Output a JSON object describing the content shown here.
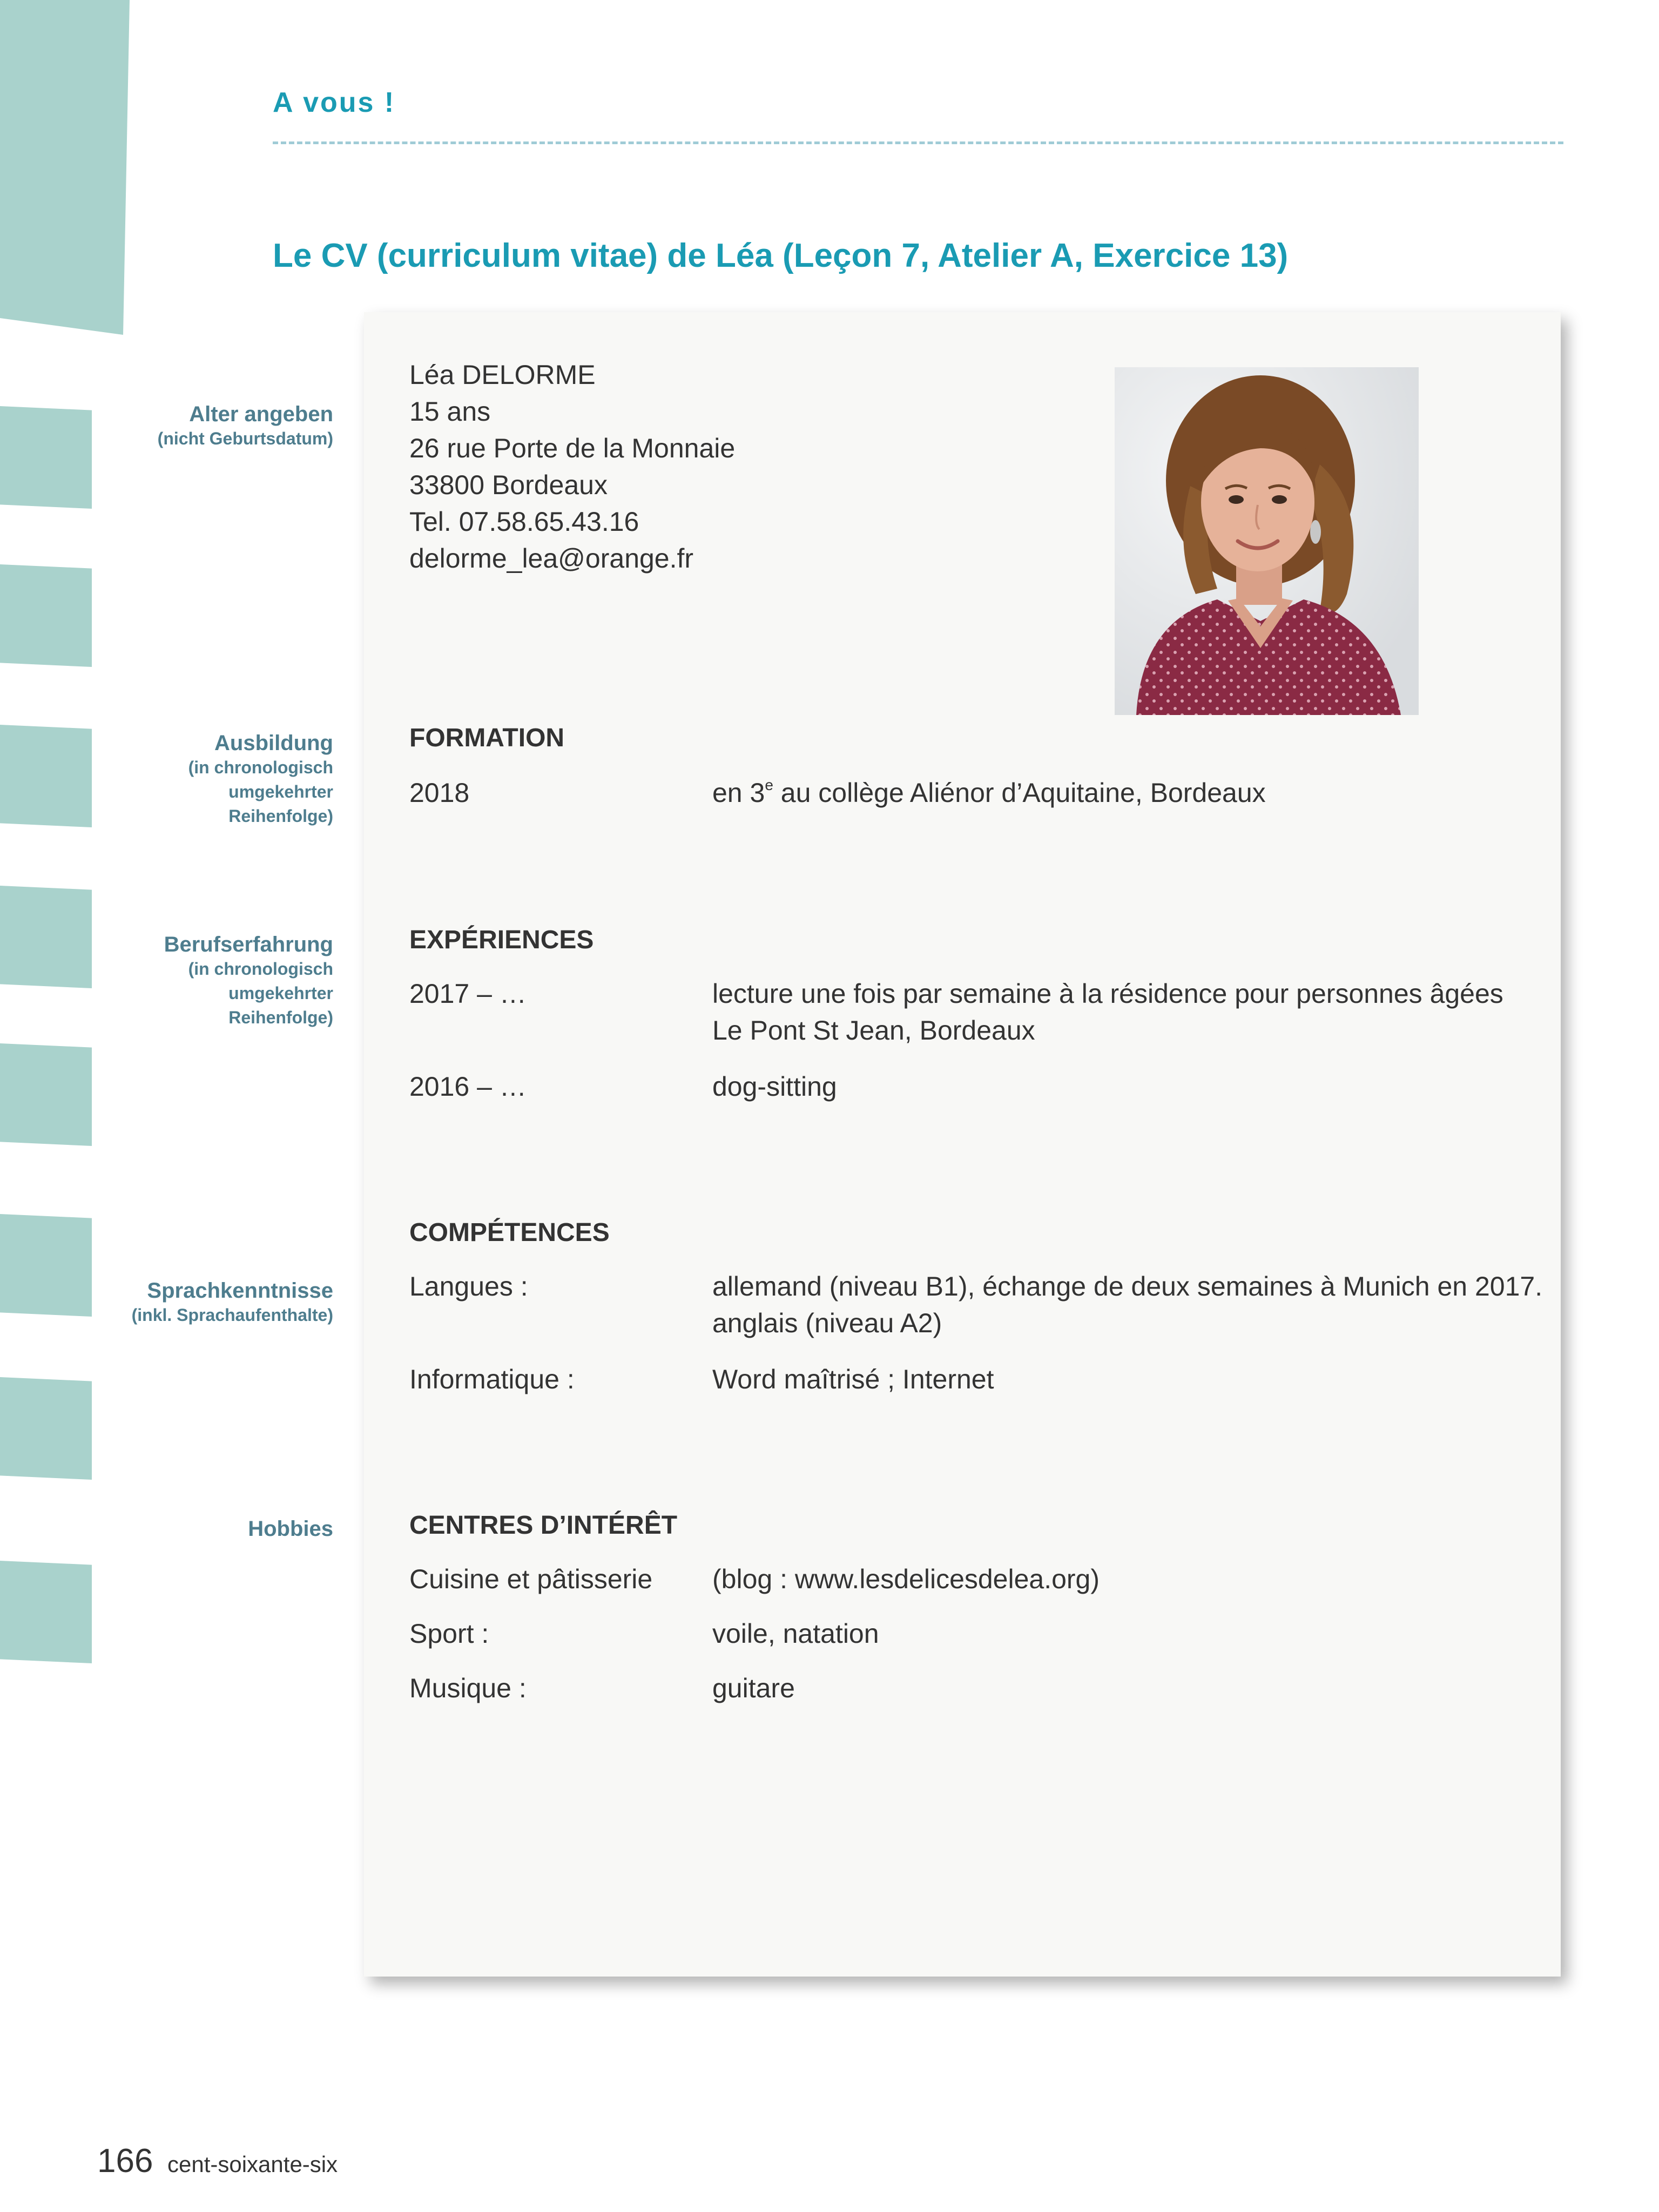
{
  "header": {
    "section": "A vous !",
    "title": "Le CV (curriculum vitae) de Léa (Leçon 7, Atelier A, Exercice 13)"
  },
  "margin_notes": [
    {
      "label": "Alter angeben",
      "note": "(nicht Geburtsdatum)"
    },
    {
      "label": "Ausbildung",
      "note": "(in chronologisch umgekehrter Reihenfolge)"
    },
    {
      "label": "Berufserfahrung",
      "note": "(in chronologisch umgekehrter Reihenfolge)"
    },
    {
      "label": "Sprachkenntnisse",
      "note": "(inkl. Sprachaufenthalte)"
    },
    {
      "label": "Hobbies",
      "note": ""
    }
  ],
  "cv": {
    "name": "Léa DELORME",
    "age": "15 ans",
    "street": "26 rue Porte de la Monnaie",
    "city": "33800 Bordeaux",
    "phone": "Tel. 07.58.65.43.16",
    "email": "delorme_lea@orange.fr",
    "formation": {
      "title": "FORMATION",
      "entries": [
        {
          "year": "2018",
          "pre": "en 3",
          "sup": "e",
          "post": " au collège Aliénor d’Aquitaine, Bordeaux"
        }
      ]
    },
    "experiences": {
      "title": "EXPÉRIENCES",
      "entries": [
        {
          "year": "2017 – …",
          "line1": "lecture une fois par semaine à la résidence pour personnes âgées",
          "line2": "Le Pont St Jean, Bordeaux"
        },
        {
          "year": "2016 – …",
          "line1": "dog-sitting",
          "line2": ""
        }
      ]
    },
    "competences": {
      "title": "COMPÉTENCES",
      "entries": [
        {
          "label": "Langues :",
          "line1": "allemand (niveau B1), échange de deux semaines à Munich en 2017.",
          "line2": "anglais (niveau A2)"
        },
        {
          "label": "Informatique :",
          "line1": "Word maîtrisé ; Internet",
          "line2": ""
        }
      ]
    },
    "interets": {
      "title": "CENTRES D’INTÉRÊT",
      "entries": [
        {
          "label": "Cuisine et pâtisserie",
          "value": "(blog : www.lesdelicesdelea.org)"
        },
        {
          "label": "Sport :",
          "value": "voile, natation"
        },
        {
          "label": "Musique :",
          "value": "guitare"
        }
      ]
    }
  },
  "footer": {
    "page_number": "166",
    "page_words": "cent-soixante-six"
  },
  "colors": {
    "accent": "#1a9bb3",
    "margin_label": "#4e7d8e",
    "side_tabs": "#a9d2cc",
    "card_background": "#f8f8f6"
  }
}
